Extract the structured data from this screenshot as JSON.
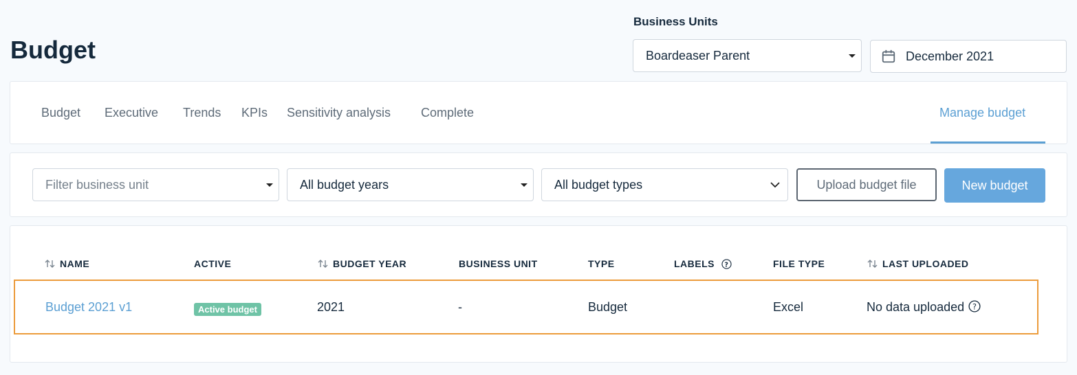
{
  "header": {
    "title": "Budget",
    "business_units_label": "Business Units",
    "business_unit_value": "Boardeaser Parent",
    "date_value": "December 2021"
  },
  "tabs": [
    {
      "label": "Budget"
    },
    {
      "label": "Executive"
    },
    {
      "label": "Trends"
    },
    {
      "label": "KPIs"
    },
    {
      "label": "Sensitivity analysis"
    },
    {
      "label": "Complete"
    },
    {
      "label": "Manage budget",
      "active": true
    }
  ],
  "filters": {
    "business_unit_placeholder": "Filter business unit",
    "budget_years": "All budget years",
    "budget_types": "All budget types",
    "upload_label": "Upload budget file",
    "new_label": "New budget"
  },
  "table": {
    "columns": {
      "name": "NAME",
      "active": "ACTIVE",
      "budget_year": "BUDGET YEAR",
      "business_unit": "BUSINESS UNIT",
      "type": "TYPE",
      "labels": "LABELS",
      "file_type": "FILE TYPE",
      "last_uploaded": "LAST UPLOADED"
    },
    "rows": [
      {
        "name": "Budget 2021 v1",
        "active": "Active budget",
        "budget_year": "2021",
        "business_unit": "-",
        "type": "Budget",
        "labels": "",
        "file_type": "Excel",
        "last_uploaded": "No data uploaded"
      }
    ]
  },
  "colors": {
    "accent": "#5b9fd3",
    "primary_button": "#66a7dd",
    "badge": "#6fc3a6",
    "highlight": "#ec9b3b"
  }
}
